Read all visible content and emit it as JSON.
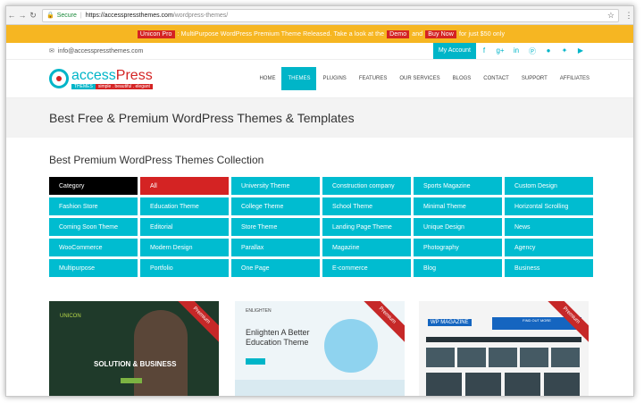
{
  "browser": {
    "secure_label": "Secure",
    "url_host": "https://accesspressthemes.com",
    "url_path": "/wordpress-themes/"
  },
  "promo": {
    "pill1": "Unicon Pro",
    "text1": ": MultiPurpose WordPress Premium Theme Released. Take a look at the",
    "pill2": "Demo",
    "text2": "and",
    "pill3": "Buy Now",
    "text3": "for just $50 only"
  },
  "topbar": {
    "email": "info@accesspressthemes.com",
    "account_label": "My Account"
  },
  "logo": {
    "name_a": "access",
    "name_b": "Press",
    "tag1": "THEMES",
    "tag2": "simple . beautiful . elegant"
  },
  "nav": [
    "HOME",
    "THEMES",
    "PLUGINS",
    "FEATURES",
    "OUR SERVICES",
    "BLOGS",
    "CONTACT",
    "SUPPORT",
    "AFFILIATES"
  ],
  "page_title": "Best Free & Premium WordPress Themes & Templates",
  "collection_title": "Best Premium WordPress Themes Collection",
  "categories": [
    "Category",
    "All",
    "University Theme",
    "Construction company",
    "Sports Magazine",
    "Custom Design",
    "Fashion Store",
    "Education Theme",
    "College Theme",
    "School Theme",
    "Minimal Theme",
    "Horizontal Scrolling",
    "Coming Soon Theme",
    "Editorial",
    "Store Theme",
    "Landing Page Theme",
    "Unique Design",
    "News",
    "WooCommerce",
    "Modern Design",
    "Parallax",
    "Magazine",
    "Photography",
    "Agency",
    "Multipurpose",
    "Portfolio",
    "One Page",
    "E-commerce",
    "Blog",
    "Business"
  ],
  "cards": {
    "ribbon": "Premium",
    "card1_brand": "UNICON",
    "card1_title": "SOLUTION & BUSINESS",
    "card2_brand": "ENLIGHTEN",
    "card2_title": "Enlighten A Better Education Theme",
    "card3_logo": "WP MAGAZINE",
    "card3_ad": "FIND OUT MORE"
  },
  "colors": {
    "accent": "#00bcd0",
    "red": "#d42323",
    "promo": "#f6b622"
  }
}
